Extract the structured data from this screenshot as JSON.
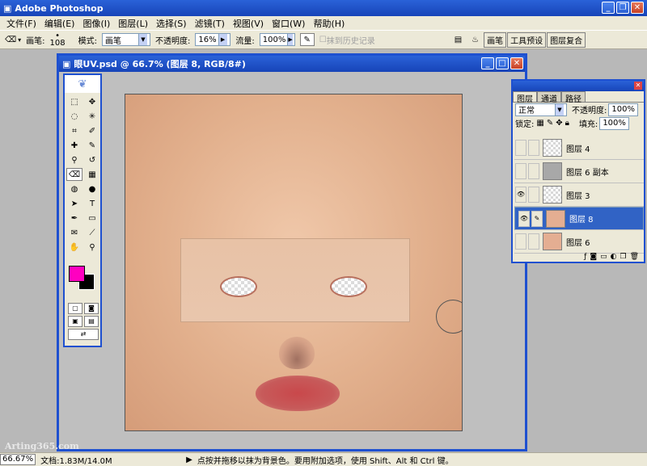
{
  "app": {
    "title": "Adobe Photoshop"
  },
  "menu": {
    "items": [
      "文件(F)",
      "编辑(E)",
      "图像(I)",
      "图层(L)",
      "选择(S)",
      "滤镜(T)",
      "视图(V)",
      "窗口(W)",
      "帮助(H)"
    ]
  },
  "options": {
    "brush_label": "画笔:",
    "brush_size": "108",
    "mode_label": "模式:",
    "mode_value": "画笔",
    "opacity_label": "不透明度:",
    "opacity_value": "16%",
    "flow_label": "流量:",
    "flow_value": "100%",
    "erase_history": "抹到历史记录",
    "dock_tabs": [
      "画笔",
      "工具预设",
      "图层复合"
    ]
  },
  "document": {
    "title": "眼UV.psd @ 66.7% (图层 8, RGB/8#)"
  },
  "layers_panel": {
    "tabs": [
      "图层",
      "通道",
      "路径"
    ],
    "blend_mode": "正常",
    "opacity_label": "不透明度:",
    "opacity_value": "100%",
    "lock_label": "锁定:",
    "fill_label": "填充:",
    "fill_value": "100%",
    "layers": [
      {
        "name": "图层 4",
        "visible": false,
        "selected": false
      },
      {
        "name": "图层 6 副本",
        "visible": false,
        "selected": false
      },
      {
        "name": "图层 3",
        "visible": true,
        "selected": false
      },
      {
        "name": "图层 8",
        "visible": true,
        "selected": true
      },
      {
        "name": "图层 6",
        "visible": false,
        "selected": false
      }
    ]
  },
  "status": {
    "zoom": "66.67%",
    "doc_info": "文档:1.83M/14.0M",
    "hint": "点按并拖移以抹为背景色。要用附加选项，使用 Shift、Alt 和 Ctrl 键。"
  },
  "watermark": "Arting365.com",
  "colors": {
    "foreground": "#ff00c0",
    "background": "#000000",
    "accent": "#1e50d0"
  }
}
